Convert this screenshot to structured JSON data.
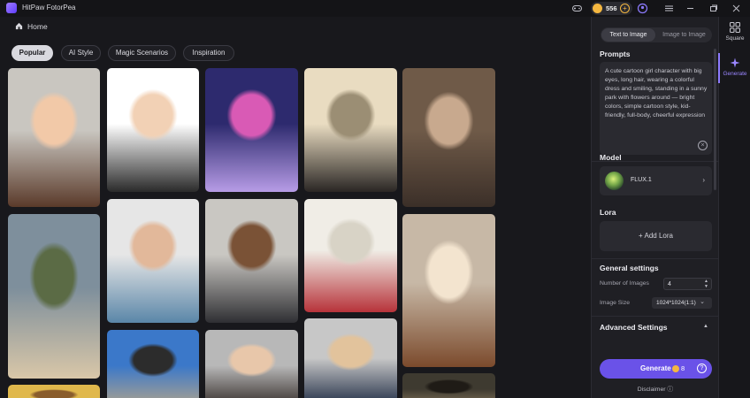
{
  "app": {
    "title": "HitPaw FotorPea",
    "coins": "556"
  },
  "titlebar_icons": [
    "gamepad-icon",
    "coin-icon",
    "plus-icon",
    "account-icon",
    "menu-icon",
    "minimize-icon",
    "maximize-icon",
    "close-icon"
  ],
  "nav": {
    "home": "Home"
  },
  "tabs": [
    {
      "label": "Popular",
      "active": true
    },
    {
      "label": "AI Style",
      "active": false
    },
    {
      "label": "Magic Scenarios",
      "active": false
    },
    {
      "label": "Inspiration",
      "active": false
    }
  ],
  "gallery": {
    "cards": [
      {
        "title": "portrait-woman-braid",
        "colors": [
          "#c9c6c0",
          "#5a3a2a",
          "#f2c9a8"
        ]
      },
      {
        "title": "cartoon-man-podium",
        "colors": [
          "#ffffff",
          "#2a2a2a",
          "#f2d1b5"
        ]
      },
      {
        "title": "purple-bunny-toy",
        "colors": [
          "#2d2a6e",
          "#b79ce6",
          "#d95ab5"
        ]
      },
      {
        "title": "old-photo-restore-man",
        "colors": [
          "#e9dcc1",
          "#2a2624",
          "#9b8e74"
        ]
      },
      {
        "title": "colorize-couple",
        "colors": [
          "#6f5a48",
          "#3b2f28",
          "#c8a98e"
        ]
      },
      {
        "title": "vintage-couple-field",
        "colors": [
          "#7e8f9c",
          "#d9c7a8",
          "#5b6b45"
        ]
      },
      {
        "title": "bald-man-glasses",
        "colors": [
          "#e6e6e6",
          "#5a86a8",
          "#e2b89a"
        ]
      },
      {
        "title": "business-woman",
        "colors": [
          "#c9c7c2",
          "#2f2f33",
          "#7a5236"
        ]
      },
      {
        "title": "le-consulat-cafe",
        "colors": [
          "#f0ede6",
          "#b7333a",
          "#d8d3c6"
        ]
      },
      {
        "title": "portrait-woman-smile",
        "colors": [
          "#c7b8a6",
          "#7b4a2c",
          "#f3e4cf"
        ]
      },
      {
        "title": "woman-street",
        "colors": [
          "#3b78c9",
          "#b5a58a",
          "#2c2c2c"
        ]
      },
      {
        "title": "couple-selfie",
        "colors": [
          "#b8b8b8",
          "#2c2420",
          "#e8c7aa"
        ]
      },
      {
        "title": "blond-man-portrait",
        "colors": [
          "#c7c7c7",
          "#1e2b44",
          "#e2c39c"
        ]
      },
      {
        "title": "autumn-scene",
        "colors": [
          "#e0b84c",
          "#a9c26b",
          "#8a5d2c"
        ]
      },
      {
        "title": "forest-woman",
        "colors": [
          "#3e3a30",
          "#8b7a5e",
          "#1f1b16"
        ]
      }
    ]
  },
  "panel": {
    "modes": [
      {
        "label": "Text to Image",
        "active": true
      },
      {
        "label": "Image to Image",
        "active": false
      }
    ],
    "prompts_title": "Prompts",
    "prompt_text": "A cute cartoon girl character with big eyes, long hair, wearing a colorful dress and smiling, standing in a sunny park with flowers around — bright colors, simple cartoon style, kid-friendly, full-body, cheerful expression",
    "model_title": "Model",
    "model_name": "FLUX.1",
    "lora_title": "Lora",
    "lora_button": "+ Add Lora",
    "general_title": "General settings",
    "num_images_label": "Number of Images",
    "num_images_value": "4",
    "image_size_label": "Image Size",
    "image_size_value": "1024*1024(1:1)",
    "advanced_title": "Advanced Settings",
    "generate_label": "Generate",
    "generate_cost": "8",
    "disclaimer": "Disclaimer"
  },
  "rail": [
    {
      "label": "Square",
      "icon": "grid-icon",
      "active": false
    },
    {
      "label": "Generate",
      "icon": "sparkle-icon",
      "active": true
    }
  ]
}
